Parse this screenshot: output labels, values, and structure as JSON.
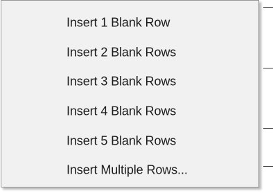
{
  "context_menu": {
    "items": [
      {
        "label": "Insert 1 Blank Row"
      },
      {
        "label": "Insert 2 Blank Rows"
      },
      {
        "label": "Insert 3 Blank Rows"
      },
      {
        "label": "Insert 4 Blank Rows"
      },
      {
        "label": "Insert 5 Blank Rows"
      },
      {
        "label": "Insert Multiple Rows..."
      }
    ]
  }
}
